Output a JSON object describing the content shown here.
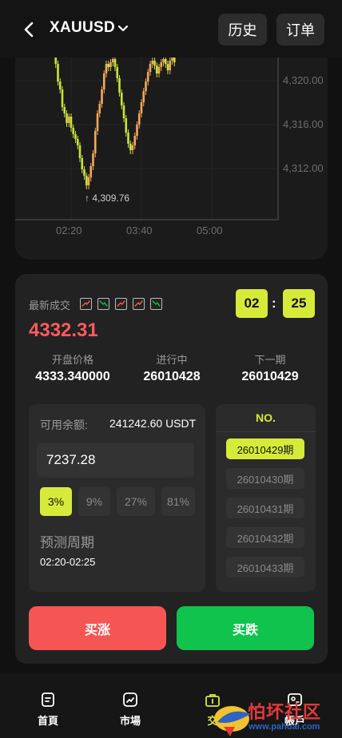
{
  "header": {
    "symbol": "XAUUSD",
    "history_label": "历史",
    "orders_label": "订单"
  },
  "chart": {
    "y_ticks": [
      "4,320.00",
      "4,316.00",
      "4,312.00"
    ],
    "x_ticks": [
      "02:20",
      "03:40",
      "05:00"
    ],
    "low_marker": "4,309.76",
    "up_color": "#f2a95a",
    "down_color": "#c7e53a"
  },
  "trade": {
    "latest_label": "最新成交",
    "recent_trends": [
      "up",
      "down",
      "up",
      "up",
      "down"
    ],
    "latest_price": "4332.31",
    "countdown_min": "02",
    "countdown_colon": ":",
    "countdown_sec": "25",
    "stats": [
      {
        "label": "开盘价格",
        "value": "4333.340000"
      },
      {
        "label": "进行中",
        "value": "26010428"
      },
      {
        "label": "下一期",
        "value": "26010429"
      }
    ],
    "balance_label": "可用余额:",
    "balance_value": "241242.60 USDT",
    "amount_value": "7237.28",
    "percent_options": [
      "3%",
      "9%",
      "27%",
      "81%"
    ],
    "percent_selected": "3%",
    "period_label": "预测周期",
    "period_value": "02:20-02:25",
    "no_title": "NO.",
    "periods": [
      "26010429期",
      "26010430期",
      "26010431期",
      "26010432期",
      "26010433期"
    ],
    "period_selected": "26010429期",
    "buy_up_label": "买涨",
    "buy_down_label": "买跌"
  },
  "bottom_nav": {
    "items": [
      {
        "label": "首頁",
        "icon": "home-doc-icon"
      },
      {
        "label": "市場",
        "icon": "market-chart-icon"
      },
      {
        "label": "交",
        "icon": "trade-bag-icon"
      },
      {
        "label": "帳戶",
        "icon": "account-card-icon"
      }
    ],
    "active_index": 2
  },
  "watermark": {
    "text": "怕坏社区",
    "url": "www.pahuai.com"
  },
  "colors": {
    "accent": "#d6ea3a",
    "price_red": "#ff5b5b",
    "buy_red": "#f55654",
    "sell_green": "#10c34d"
  }
}
